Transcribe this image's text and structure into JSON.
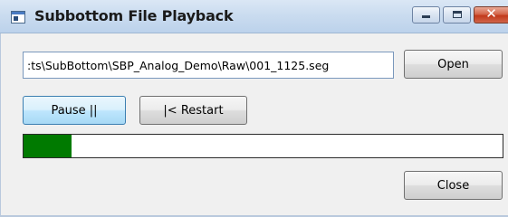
{
  "window": {
    "title": "Subbottom File Playback",
    "close_glyph": "✕"
  },
  "file": {
    "path_value": ":ts\\SubBottom\\SBP_Analog_Demo\\Raw\\001_1125.seg"
  },
  "buttons": {
    "open": "Open",
    "pause": "Pause ||",
    "restart": "|< Restart",
    "close": "Close"
  },
  "progress": {
    "fraction": 0.1,
    "color": "#007a00"
  },
  "icons": [
    "app-window-icon",
    "minimize-icon",
    "maximize-icon",
    "close-icon"
  ]
}
